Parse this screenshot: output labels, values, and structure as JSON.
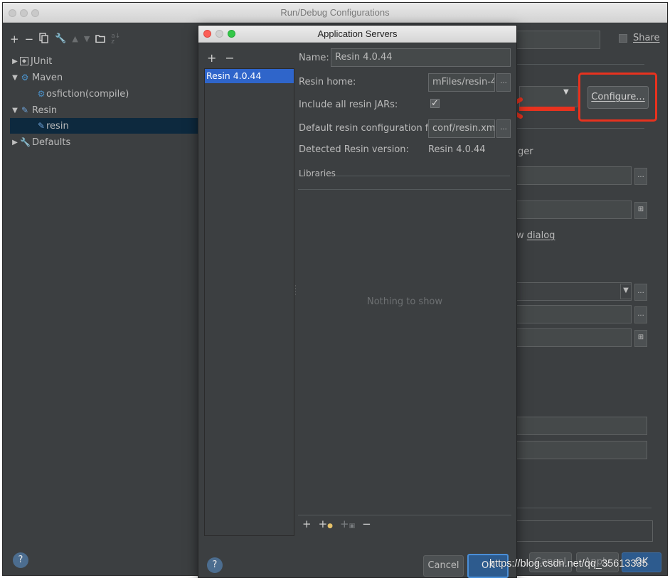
{
  "outer": {
    "title": "Run/Debug Configurations",
    "share_label": "Share",
    "configure_label": "Configure...",
    "partial_ger": "ger",
    "partial_dialog_prefix": "w ",
    "partial_dialog_word": "dialog",
    "cancel_label": "Cancel",
    "apply_label": "Apply",
    "ok_label": "OK",
    "help_label": "?"
  },
  "tree": {
    "items": [
      {
        "label": "JUnit",
        "icon": "junit-icon",
        "expanded": false
      },
      {
        "label": "Maven",
        "icon": "maven-gear-icon",
        "expanded": true
      },
      {
        "label": "osfiction(compile)",
        "icon": "maven-gear-icon"
      },
      {
        "label": "Resin",
        "icon": "resin-wrench-icon",
        "expanded": true
      },
      {
        "label": "resin",
        "icon": "resin-wrench-icon",
        "selected": true
      },
      {
        "label": "Defaults",
        "icon": "defaults-wrench-icon",
        "expanded": false
      }
    ]
  },
  "dialog": {
    "title": "Application Servers",
    "servers": [
      "Resin 4.0.44"
    ],
    "name_label": "Name:",
    "name_value": "Resin 4.0.44",
    "home_label": "Resin home:",
    "home_value": "mFiles/resin-4",
    "include_jars_label": "Include all resin JARs:",
    "include_jars_checked": true,
    "config_file_label": "Default resin configuration file:",
    "config_file_value": "conf/resin.xml",
    "detected_label": "Detected Resin version:",
    "detected_value": "Resin 4.0.44",
    "libraries_label": "Libraries",
    "empty_text": "Nothing to show",
    "cancel_label": "Cancel",
    "ok_label": "OK",
    "help_label": "?",
    "ellipsis": "..."
  },
  "annotation": {
    "highlight_color": "#e8321e"
  },
  "watermark": "https://blog.csdn.net/qq_35613335",
  "colors": {
    "panel_bg": "#3c3f41",
    "selection": "#2f65ca",
    "tree_selection": "#0d293e",
    "primary_button": "#2d5b8e"
  }
}
